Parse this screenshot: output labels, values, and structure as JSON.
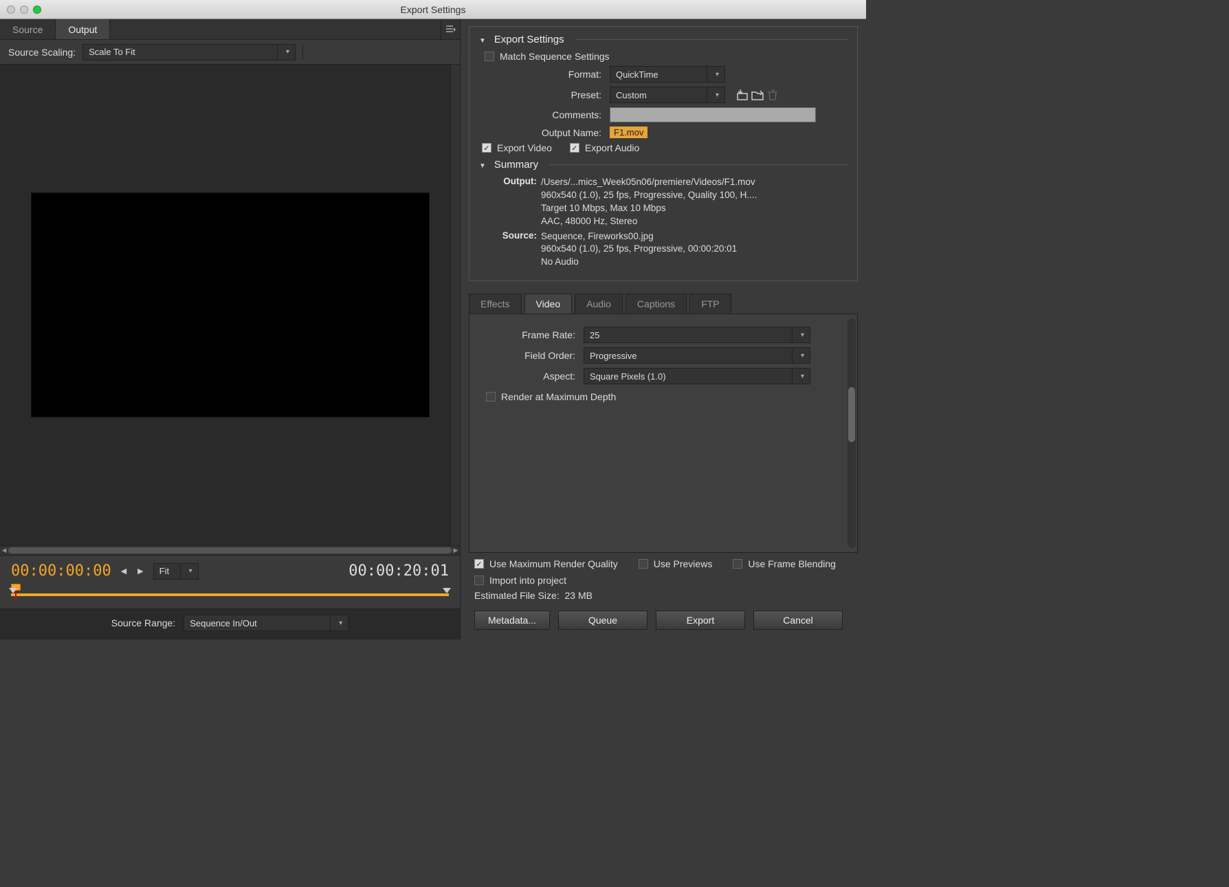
{
  "window": {
    "title": "Export Settings"
  },
  "left": {
    "tabs": {
      "source": "Source",
      "output": "Output"
    },
    "source_scaling_label": "Source Scaling:",
    "source_scaling_value": "Scale To Fit",
    "tc_in": "00:00:00:00",
    "tc_out": "00:00:20:01",
    "fit_label": "Fit",
    "source_range_label": "Source Range:",
    "source_range_value": "Sequence In/Out"
  },
  "export": {
    "header": "Export Settings",
    "match_seq": "Match Sequence Settings",
    "format_label": "Format:",
    "format_value": "QuickTime",
    "preset_label": "Preset:",
    "preset_value": "Custom",
    "comments_label": "Comments:",
    "output_name_label": "Output Name:",
    "output_name_value": "F1.mov",
    "export_video": "Export Video",
    "export_audio": "Export Audio",
    "summary_header": "Summary",
    "summary": {
      "output_label": "Output:",
      "output_path": "/Users/...mics_Week05n06/premiere/Videos/F1.mov",
      "output_line2": "960x540 (1.0), 25 fps, Progressive, Quality 100, H....",
      "output_line3": "Target 10 Mbps, Max 10 Mbps",
      "output_line4": "AAC, 48000 Hz, Stereo",
      "source_label": "Source:",
      "source_line1": "Sequence, Fireworks00.jpg",
      "source_line2": "960x540 (1.0), 25 fps, Progressive, 00:00:20:01",
      "source_line3": "No Audio"
    }
  },
  "subtabs": {
    "effects": "Effects",
    "video": "Video",
    "audio": "Audio",
    "captions": "Captions",
    "ftp": "FTP"
  },
  "video": {
    "frame_rate_label": "Frame Rate:",
    "frame_rate_value": "25",
    "field_order_label": "Field Order:",
    "field_order_value": "Progressive",
    "aspect_label": "Aspect:",
    "aspect_value": "Square Pixels (1.0)",
    "render_max_depth": "Render at Maximum Depth"
  },
  "options": {
    "use_max_quality": "Use Maximum Render Quality",
    "use_previews": "Use Previews",
    "use_frame_blending": "Use Frame Blending",
    "import_into_project": "Import into project",
    "est_label": "Estimated File Size:",
    "est_value": "23 MB"
  },
  "buttons": {
    "metadata": "Metadata...",
    "queue": "Queue",
    "export": "Export",
    "cancel": "Cancel"
  }
}
